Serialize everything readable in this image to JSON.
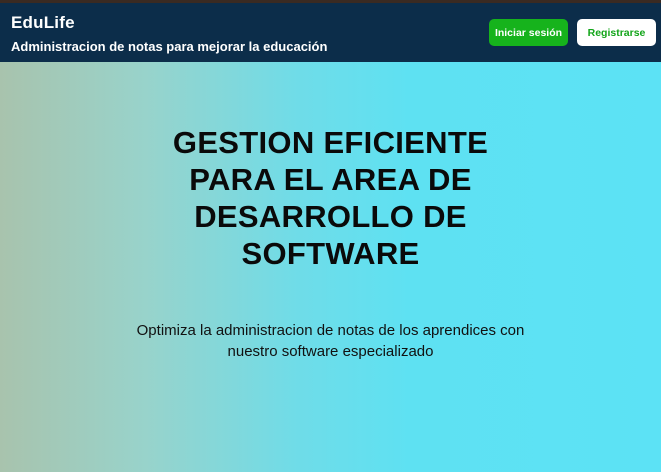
{
  "header": {
    "brand": "EduLife",
    "tagline": "Administracion de notas para mejorar la educación",
    "login_label": "Iniciar sesión",
    "register_label": "Registrarse"
  },
  "hero": {
    "title": "GESTION EFICIENTE PARA EL AREA DE DESARROLLO DE SOFTWARE",
    "subtitle": "Optimiza la administracion de notas de los aprendices con nuestro software especializado"
  },
  "colors": {
    "header_bg": "#0c2d4a",
    "login_button_bg": "#16b31c",
    "register_button_text": "#13a51a",
    "hero_gradient_start": "#a8c3ad",
    "hero_gradient_end": "#5ce2f5"
  }
}
